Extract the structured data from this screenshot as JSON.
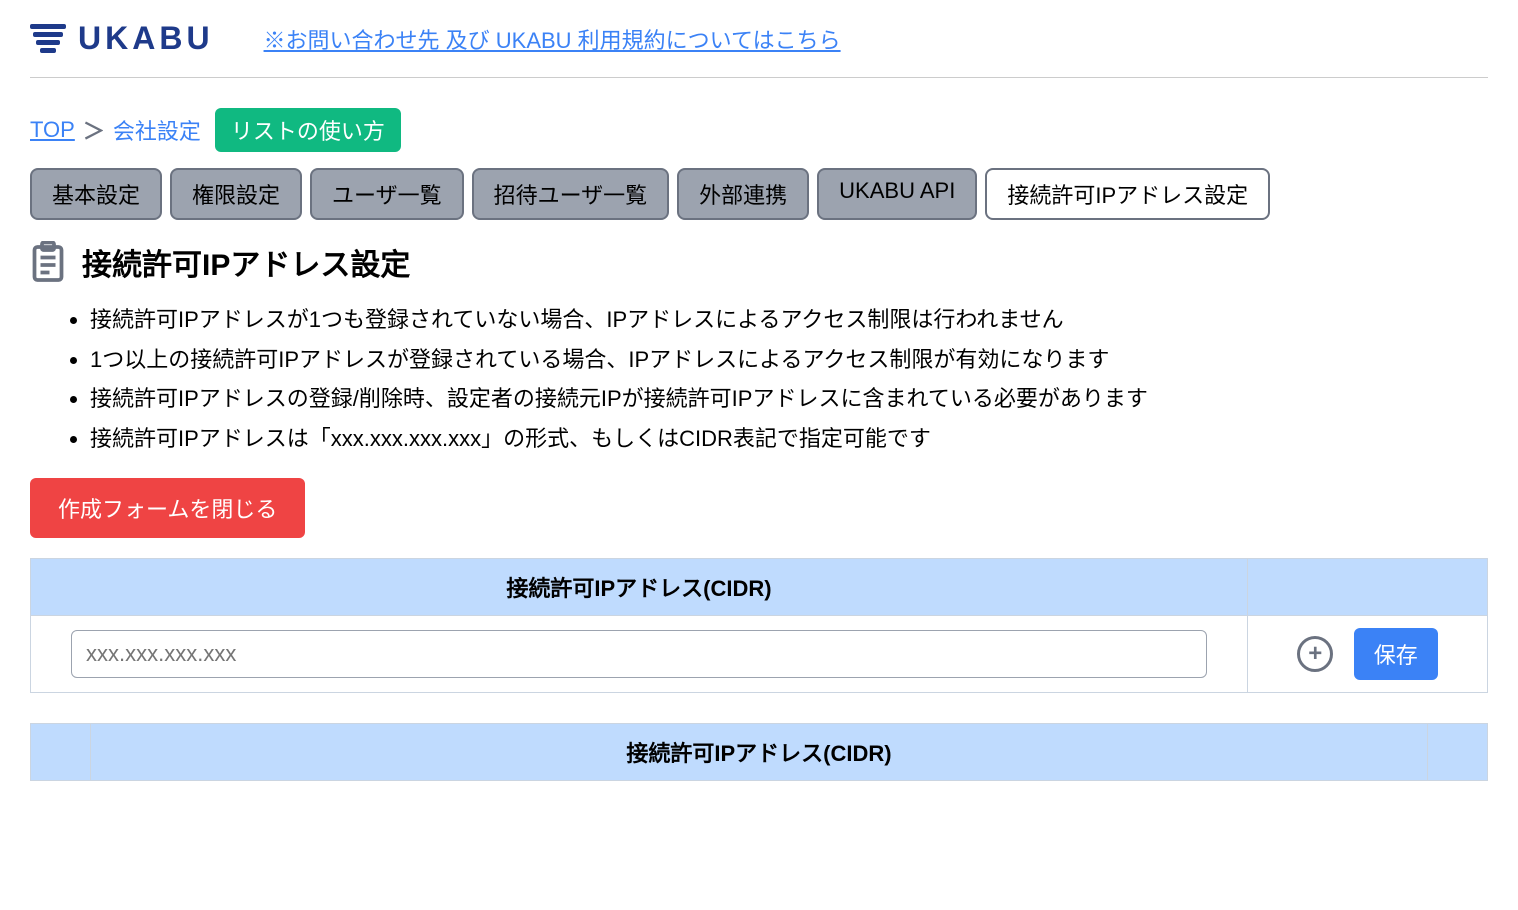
{
  "header": {
    "logo_text": "UKABU",
    "contact_link": "※お問い合わせ先 及び UKABU 利用規約についてはこちら"
  },
  "breadcrumb": {
    "top": "TOP",
    "separator": "＞",
    "current": "会社設定",
    "usage_badge": "リストの使い方"
  },
  "tabs": [
    {
      "label": "基本設定",
      "active": false
    },
    {
      "label": "権限設定",
      "active": false
    },
    {
      "label": "ユーザ一覧",
      "active": false
    },
    {
      "label": "招待ユーザ一覧",
      "active": false
    },
    {
      "label": "外部連携",
      "active": false
    },
    {
      "label": "UKABU API",
      "active": false
    },
    {
      "label": "接続許可IPアドレス設定",
      "active": true
    }
  ],
  "section": {
    "title": "接続許可IPアドレス設定",
    "notes": [
      "接続許可IPアドレスが1つも登録されていない場合、IPアドレスによるアクセス制限は行われません",
      "1つ以上の接続許可IPアドレスが登録されている場合、IPアドレスによるアクセス制限が有効になります",
      "接続許可IPアドレスの登録/削除時、設定者の接続元IPが接続許可IPアドレスに含まれている必要があります",
      "接続許可IPアドレスは「xxx.xxx.xxx.xxx」の形式、もしくはCIDR表記で指定可能です"
    ]
  },
  "form": {
    "close_button": "作成フォームを閉じる",
    "header": "接続許可IPアドレス(CIDR)",
    "input_placeholder": "xxx.xxx.xxx.xxx",
    "input_value": "",
    "save_button": "保存"
  },
  "list": {
    "header": "接続許可IPアドレス(CIDR)"
  }
}
